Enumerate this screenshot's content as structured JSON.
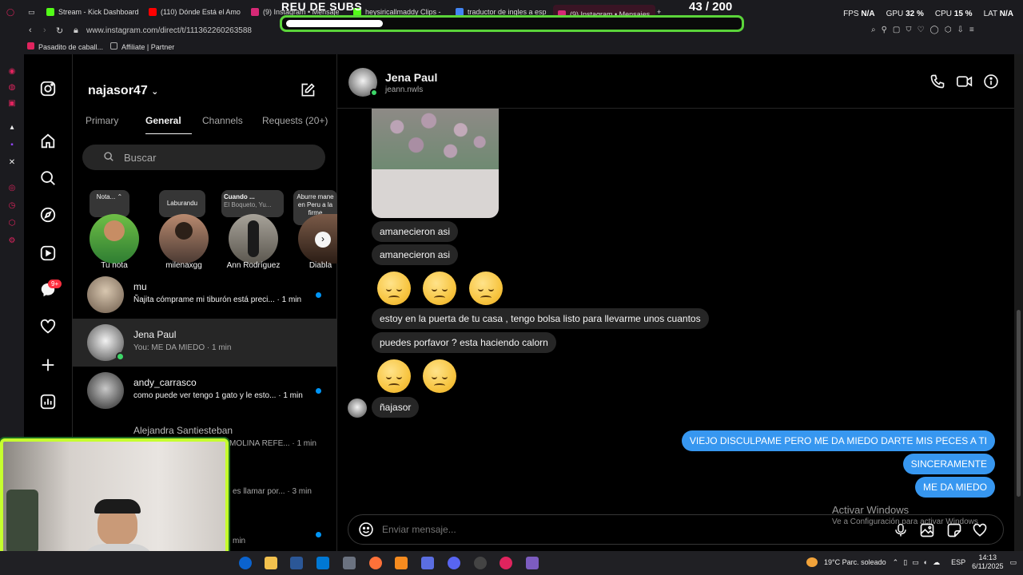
{
  "browser": {
    "tabs": [
      {
        "label": "Stream - Kick Dashboard",
        "color": "#53fc18"
      },
      {
        "label": "(110) Dónde Está el Amor",
        "color": "#ff0000"
      },
      {
        "label": "(9) Instagram • Mensajes",
        "color": "#d62976"
      },
      {
        "label": "heysiricallmaddy Clips -",
        "color": "#53fc18"
      },
      {
        "label": "traductor de ingles a esp",
        "color": "#4285f4"
      },
      {
        "label": "(9) Instagram • Mensajes",
        "color": "#d62976"
      }
    ],
    "new_tab": "+",
    "url": "www.instagram.com/direct/t/111362260263588",
    "bookmarks": [
      "Pasadito de caball...",
      "Affiliate | Partner"
    ]
  },
  "overlay": {
    "subs_title": "REU DE SUBS",
    "subs_count": "43  / 200",
    "subs_progress": 0.215,
    "perf": [
      {
        "label": "FPS",
        "value": "N/A"
      },
      {
        "label": "GPU",
        "value": "32 %"
      },
      {
        "label": "CPU",
        "value": "15 %"
      },
      {
        "label": "LAT",
        "value": "N/A"
      }
    ]
  },
  "instagram": {
    "username": "najasor47",
    "tabs": [
      "Primary",
      "General",
      "Channels",
      "Requests (20+)"
    ],
    "selected_tab": "General",
    "search_placeholder": "Buscar",
    "notifications_badge": "9+",
    "notes": [
      {
        "note": "Nota...",
        "name": "Tu nota"
      },
      {
        "note": "Laburandu",
        "name": "milenaxgg"
      },
      {
        "note": "Cuando ...",
        "note2": "El Boqueto, Yu...",
        "name": "Ann Rodríguez"
      },
      {
        "note": "Aburre mane en Peru a la firme",
        "name": "Diabla"
      }
    ],
    "threads": [
      {
        "name": "mu",
        "preview": "Ñajita cómprame mi tiburón está preci... · 1 min",
        "unread": true
      },
      {
        "name": "Jena Paul",
        "preview": "You: ME DA MIEDO · 1 min",
        "unread": false
      },
      {
        "name": "andy_carrasco",
        "preview": "como puede ver tengo 1 gato y le esto... · 1 min",
        "unread": true
      },
      {
        "name": "Alejandra Santiesteban",
        "preview": "MOLINA REFE... · 1 min",
        "unread": false
      },
      {
        "name": "",
        "preview": "es llamar por... · 3 min",
        "unread": false
      },
      {
        "name": "",
        "preview": "min",
        "unread": true
      }
    ]
  },
  "chat": {
    "contact_name": "Jena Paul",
    "contact_handle": "jeann.nwls",
    "messages_in": [
      "amanecieron asi",
      "amanecieron asi",
      "estoy en la puerta de tu casa , tengo bolsa listo para llevarme unos cuantos",
      "puedes porfavor ?  esta haciendo calorn",
      "ñajasor"
    ],
    "messages_out": [
      "VIEJO DISCULPAME PERO ME DA MIEDO DARTE MIS PECES A TI",
      "SINCERAMENTE",
      "ME DA MIEDO"
    ],
    "composer_placeholder": "Enviar mensaje...",
    "watermark_title": "Activar Windows",
    "watermark_sub": "Ve a Configuración para activar Windows"
  },
  "taskbar": {
    "weather": "19°C  Parc. soleado",
    "lang": "ESP",
    "time": "14:13",
    "date": "6/11/2025"
  }
}
